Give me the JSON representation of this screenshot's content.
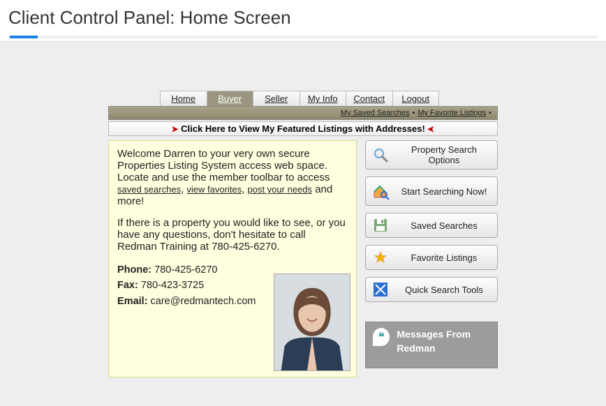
{
  "header": {
    "title": "Client Control Panel: Home Screen"
  },
  "tabs": [
    {
      "label": "Home"
    },
    {
      "label": "Buyer"
    },
    {
      "label": "Seller"
    },
    {
      "label": "My Info"
    },
    {
      "label": "Contact"
    },
    {
      "label": "Logout"
    }
  ],
  "subbar": {
    "saved": "My Saved Searches",
    "fav": "My Favorite Listings"
  },
  "featured": {
    "text": "Click Here to View My Featured Listings with Addresses!"
  },
  "welcome": {
    "p1a": "Welcome Darren to your very own secure Properties Listing System access web space. Locate and use the member toolbar to access ",
    "link1": "saved searches",
    "link2": "view favorites",
    "link3": "post your needs",
    "p1b": " and more!",
    "p2": "If there is a property you would like to see, or you have any questions, don't hesitate to call Redman Training at 780-425-6270.",
    "phone_label": "Phone:",
    "phone": " 780-425-6270",
    "fax_label": "Fax:",
    "fax": " 780-423-3725",
    "email_label": "Email:",
    "email": " care@redmantech.com"
  },
  "side": {
    "b1": "Property Search Options",
    "b2": "Start Searching Now!",
    "b3": "Saved Searches",
    "b4": "Favorite Listings",
    "b5": "Quick Search Tools"
  },
  "messages": {
    "title": "Messages From Redman"
  }
}
